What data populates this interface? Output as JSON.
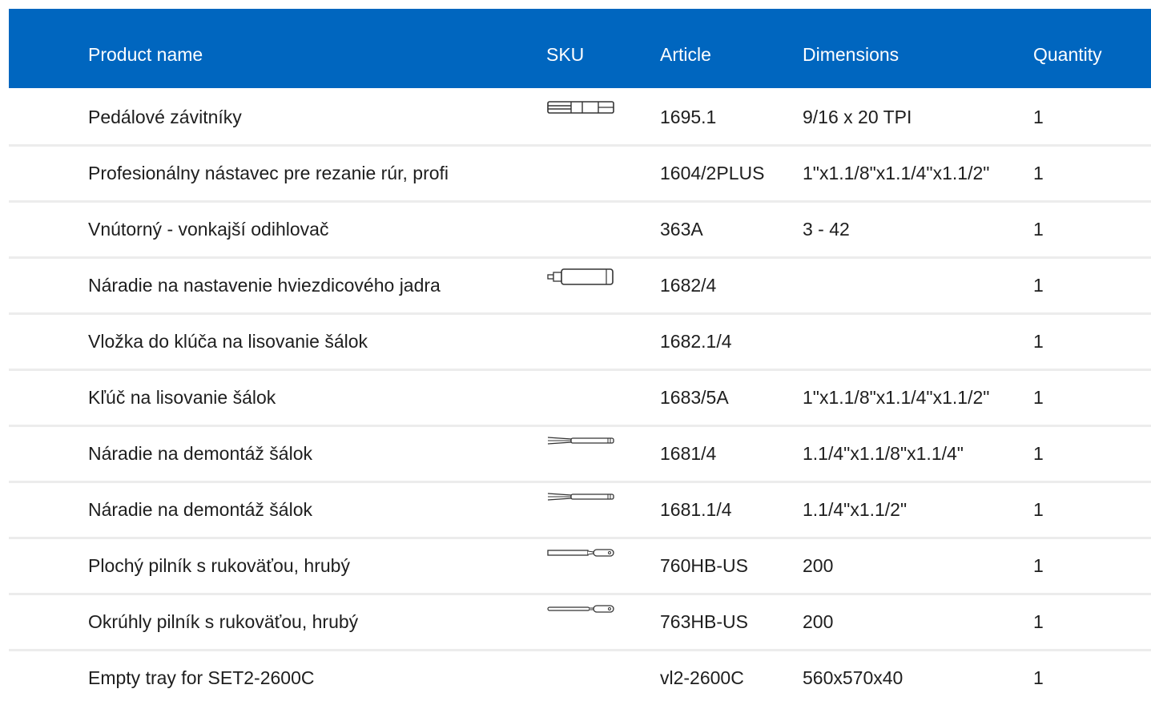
{
  "header": {
    "name": "Product name",
    "sku": "SKU",
    "article": "Article",
    "dimensions": "Dimensions",
    "quantity": "Quantity"
  },
  "colors": {
    "header_bg": "#0066bf",
    "header_text": "#ffffff",
    "row_divider": "#ececec"
  },
  "rows": [
    {
      "name": "Pedálové závitníky",
      "sku_icon": "tap-tool-icon",
      "article": "1695.1",
      "dimensions": "9/16 x 20 TPI",
      "quantity": "1"
    },
    {
      "name": "Profesionálny nástavec pre rezanie rúr, profi",
      "sku_icon": "",
      "article": "1604/2PLUS",
      "dimensions": "1\"x1.1/8\"x1.1/4\"x1.1/2\"",
      "quantity": "1"
    },
    {
      "name": "Vnútorný - vonkajší odihlovač",
      "sku_icon": "",
      "article": "363A",
      "dimensions": "3 - 42",
      "quantity": "1"
    },
    {
      "name": "Náradie na nastavenie hviezdicového jadra",
      "sku_icon": "star-nut-setter-icon",
      "article": "1682/4",
      "dimensions": "",
      "quantity": "1"
    },
    {
      "name": "Vložka do klúča na lisovanie šálok",
      "sku_icon": "",
      "article": "1682.1/4",
      "dimensions": "",
      "quantity": "1"
    },
    {
      "name": "Kľúč na lisovanie šálok",
      "sku_icon": "",
      "article": "1683/5A",
      "dimensions": "1\"x1.1/8\"x1.1/4\"x1.1/2\"",
      "quantity": "1"
    },
    {
      "name": "Náradie na demontáž šálok",
      "sku_icon": "cup-remover-icon",
      "article": "1681/4",
      "dimensions": "1.1/4\"x1.1/8\"x1.1/4\"",
      "quantity": "1"
    },
    {
      "name": "Náradie na demontáž šálok",
      "sku_icon": "cup-remover-icon",
      "article": "1681.1/4",
      "dimensions": "1.1/4\"x1.1/2\"",
      "quantity": "1"
    },
    {
      "name": "Plochý pilník s rukoväťou, hrubý",
      "sku_icon": "flat-file-icon",
      "article": "760HB-US",
      "dimensions": "200",
      "quantity": "1"
    },
    {
      "name": "Okrúhly pilník s rukoväťou, hrubý",
      "sku_icon": "round-file-icon",
      "article": "763HB-US",
      "dimensions": "200",
      "quantity": "1"
    },
    {
      "name": "Empty tray for SET2-2600C",
      "sku_icon": "",
      "article": "vl2-2600C",
      "dimensions": "560x570x40",
      "quantity": "1"
    }
  ]
}
